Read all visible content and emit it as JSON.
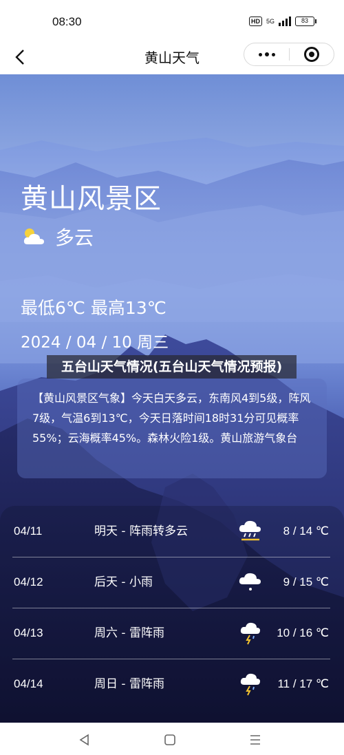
{
  "status_bar": {
    "time": "08:30",
    "hd": "HD",
    "network": "5G",
    "battery": "83"
  },
  "nav": {
    "title": "黄山天气"
  },
  "hero": {
    "location": "黄山风景区",
    "condition": "多云",
    "temp_range": "最低6℃ 最高13℃",
    "date": "2024 / 04 / 10  周三"
  },
  "overlay_title": "五台山天气情况(五台山天气情况预报)",
  "description": "【黄山风景区气象】今天白天多云，东南风4到5级，阵风7级，气温6到13℃，今天日落时间18时31分可见概率55%；云海概率45%。森林火险1级。黄山旅游气象台",
  "forecast": [
    {
      "date": "04/11",
      "weather": "明天 - 阵雨转多云",
      "icon": "rain-cloud-sun-icon",
      "temp": "8 / 14 ℃"
    },
    {
      "date": "04/12",
      "weather": "后天 - 小雨",
      "icon": "light-rain-icon",
      "temp": "9 / 15 ℃"
    },
    {
      "date": "04/13",
      "weather": "周六 - 雷阵雨",
      "icon": "thunderstorm-icon",
      "temp": "10 / 16 ℃"
    },
    {
      "date": "04/14",
      "weather": "周日 - 雷阵雨",
      "icon": "thunderstorm-icon",
      "temp": "11 / 17 ℃"
    }
  ]
}
